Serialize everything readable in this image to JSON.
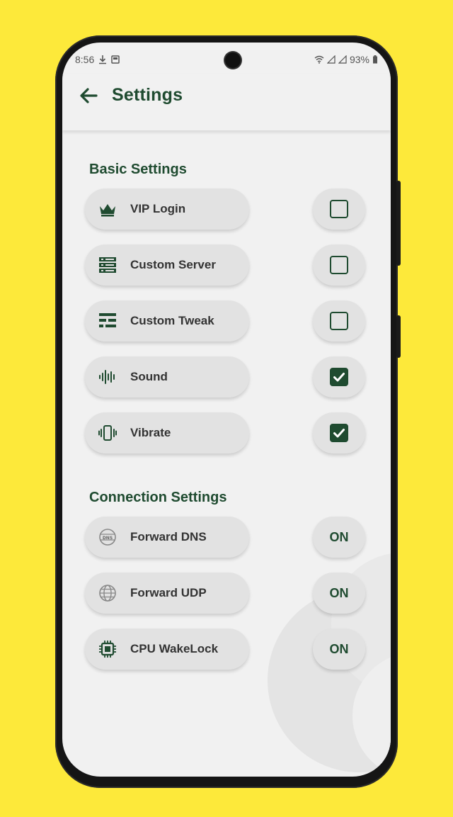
{
  "status_bar": {
    "time": "8:56",
    "battery": "93%"
  },
  "header": {
    "title": "Settings"
  },
  "basic": {
    "title": "Basic Settings",
    "items": [
      {
        "label": "VIP Login",
        "icon": "crown-icon",
        "checked": false
      },
      {
        "label": "Custom Server",
        "icon": "server-icon",
        "checked": false
      },
      {
        "label": "Custom Tweak",
        "icon": "tweak-icon",
        "checked": false
      },
      {
        "label": "Sound",
        "icon": "sound-wave-icon",
        "checked": true
      },
      {
        "label": "Vibrate",
        "icon": "vibrate-icon",
        "checked": true
      }
    ]
  },
  "connection": {
    "title": "Connection Settings",
    "items": [
      {
        "label": "Forward DNS",
        "icon": "dns-icon",
        "value": "ON"
      },
      {
        "label": "Forward UDP",
        "icon": "globe-icon",
        "value": "ON"
      },
      {
        "label": "CPU WakeLock",
        "icon": "cpu-icon",
        "value": "ON"
      }
    ]
  },
  "colors": {
    "accent": "#1F4B30",
    "background": "#FDE93A",
    "surface": "#F1F1F1",
    "pill": "#E2E2E2"
  }
}
